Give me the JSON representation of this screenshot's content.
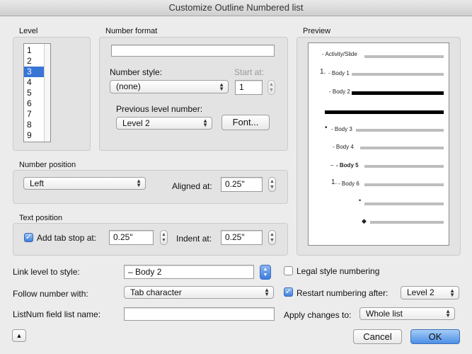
{
  "window": {
    "title": "Customize Outline Numbered list"
  },
  "level": {
    "group_label": "Level",
    "items": [
      "1",
      "2",
      "3",
      "4",
      "5",
      "6",
      "7",
      "8",
      "9"
    ],
    "selected": "3"
  },
  "number_format": {
    "group_label": "Number format",
    "format_value": "",
    "number_style_label": "Number style:",
    "number_style_value": "(none)",
    "start_at_label": "Start at:",
    "start_at_value": "1",
    "previous_level_label": "Previous level number:",
    "previous_level_value": "Level 2",
    "font_button": "Font..."
  },
  "preview": {
    "group_label": "Preview",
    "lines": [
      {
        "prefix": "",
        "text": "- Activity/Slide"
      },
      {
        "prefix": "1.",
        "text": "- Body 1"
      },
      {
        "prefix": "",
        "text": "- Body 2"
      },
      {
        "prefix": "•",
        "text": "- Body 3"
      },
      {
        "prefix": "",
        "text": "- Body 4"
      },
      {
        "prefix": "–",
        "text": "- Body 5"
      },
      {
        "prefix": "1.",
        "text": "- Body 6"
      },
      {
        "prefix": "•",
        "text": ""
      },
      {
        "prefix": "◆",
        "text": ""
      }
    ]
  },
  "number_position": {
    "group_label": "Number position",
    "alignment_value": "Left",
    "aligned_at_label": "Aligned at:",
    "aligned_at_value": "0.25\""
  },
  "text_position": {
    "group_label": "Text position",
    "add_tab_stop_label": "Add tab stop at:",
    "add_tab_stop_checked": true,
    "tab_stop_value": "0.25\"",
    "indent_at_label": "Indent at:",
    "indent_at_value": "0.25\""
  },
  "bottom": {
    "link_level_label": "Link level to style:",
    "link_level_value": "– Body 2",
    "follow_number_label": "Follow number with:",
    "follow_number_value": "Tab character",
    "listnum_label": "ListNum field list name:",
    "listnum_value": "",
    "legal_style_label": "Legal style numbering",
    "legal_style_checked": false,
    "restart_label": "Restart numbering after:",
    "restart_checked": true,
    "restart_value": "Level 2",
    "apply_changes_label": "Apply changes to:",
    "apply_changes_value": "Whole list"
  },
  "buttons": {
    "collapse_glyph": "▲",
    "cancel": "Cancel",
    "ok": "OK"
  },
  "colors": {
    "accent": "#3875d7",
    "background": "#ececec",
    "group_fill": "#e3e3e3"
  }
}
